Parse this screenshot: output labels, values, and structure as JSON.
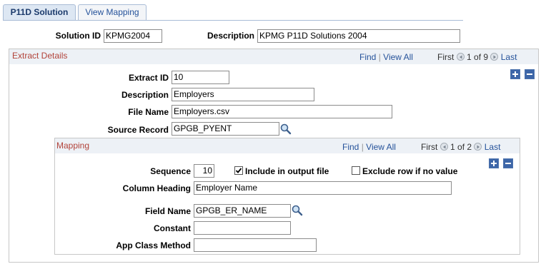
{
  "tabs": [
    {
      "label": "P11D Solution",
      "active": true
    },
    {
      "label": "View Mapping",
      "active": false
    }
  ],
  "solution": {
    "id_label": "Solution ID",
    "id_value": "KPMG2004",
    "description_label": "Description",
    "description_value": "KPMG P11D Solutions 2004"
  },
  "extract": {
    "title": "Extract Details",
    "nav": {
      "find": "Find",
      "sep": "|",
      "view_all": "View All",
      "first": "First",
      "page": "1 of 9",
      "last": "Last"
    },
    "extract_id_label": "Extract ID",
    "extract_id_value": "10",
    "description_label": "Description",
    "description_value": "Employers",
    "file_name_label": "File Name",
    "file_name_value": "Employers.csv",
    "source_record_label": "Source Record",
    "source_record_value": "GPGB_PYENT"
  },
  "mapping": {
    "title": "Mapping",
    "nav": {
      "find": "Find",
      "sep": "|",
      "view_all": "View All",
      "first": "First",
      "page": "1 of 2",
      "last": "Last"
    },
    "sequence_label": "Sequence",
    "sequence_value": "10",
    "include_label": "Include in output file",
    "include_checked": true,
    "exclude_label": "Exclude row if no value",
    "exclude_checked": false,
    "column_heading_label": "Column Heading",
    "column_heading_value": "Employer Name",
    "field_name_label": "Field Name",
    "field_name_value": "GPGB_ER_NAME",
    "constant_label": "Constant",
    "constant_value": "",
    "app_class_label": "App Class Method",
    "app_class_value": ""
  },
  "colors": {
    "section_title": "#b2433a",
    "link": "#25529a",
    "header_bg": "#edf1f6",
    "button_blue": "#3d66a8"
  },
  "icons": [
    "magnifier-icon",
    "add-row-icon",
    "delete-row-icon",
    "previous-icon",
    "next-icon",
    "checkmark-icon"
  ]
}
